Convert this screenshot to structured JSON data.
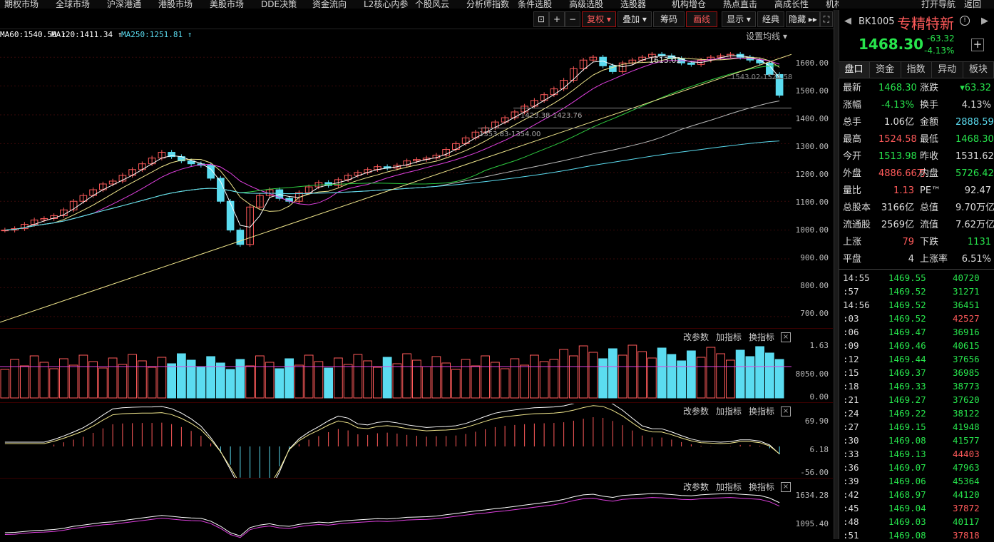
{
  "menu": {
    "items": [
      "期权市场",
      "全球市场",
      "沪深港通",
      "港股市场",
      "美股市场",
      "DDE决策",
      "资金流向",
      "L2核心内参",
      "个股风云",
      "分析师指数",
      "条件选股",
      "高级选股",
      "选股器",
      "机构增仓",
      "热点直击",
      "高成长性",
      "机构推荐"
    ],
    "right": [
      "打开导航",
      "返回"
    ]
  },
  "toolbar": {
    "buttons": [
      "+",
      "−",
      "复权 ▾",
      "叠加 ▾",
      "筹码",
      "画线",
      "显示 ▾",
      "经典",
      "隐藏 ▸▸"
    ]
  },
  "ma_legend": [
    {
      "text": "MA60:1540.50 ↑",
      "color": "#ffffff"
    },
    {
      "text": "MA120:1411.34 ↑",
      "color": "#ffffff"
    },
    {
      "text": "MA250:1251.81 ↑",
      "color": "#5bdcf0"
    }
  ],
  "settings_label": "设置均线 ▾",
  "price_axis": [
    "1600.00",
    "1500.00",
    "1400.00",
    "1300.00",
    "1200.00",
    "1100.00",
    "1000.00",
    "900.00",
    "800.00",
    "700.00"
  ],
  "annotations": {
    "high": "1613.02",
    "mid": "1543.02-1524.58",
    "line1": "1423.38-1423.76",
    "line2": "1353.83-1354.00"
  },
  "volume_axis": [
    "1.63",
    "8050.00",
    "0.00"
  ],
  "macd_axis": [
    "69.90",
    "6.18",
    "-56.00"
  ],
  "bottom_axis": [
    "1634.28",
    "1095.40"
  ],
  "pane_buttons": [
    "改参数",
    "加指标",
    "换指标"
  ],
  "stock": {
    "code": "BK1005",
    "name": "专精特新",
    "price": "1468.30",
    "change": "-63.32",
    "pct": "-4.13%"
  },
  "tabs": [
    "盘口",
    "资金",
    "指数",
    "异动",
    "板块"
  ],
  "quote": [
    [
      {
        "k": "最新",
        "v": "1468.30",
        "vc": "g"
      },
      {
        "k": "涨跌",
        "v": "▾63.32",
        "vc": "g"
      }
    ],
    [
      {
        "k": "涨幅",
        "v": "-4.13%",
        "vc": "g"
      },
      {
        "k": "换手",
        "v": "4.13%",
        "vc": "w"
      }
    ],
    [
      {
        "k": "总手",
        "v": "1.06亿",
        "vc": "w"
      },
      {
        "k": "金额",
        "v": "2888.59亿",
        "vc": "c"
      }
    ],
    [
      {
        "k": "最高",
        "v": "1524.58",
        "vc": "r"
      },
      {
        "k": "最低",
        "v": "1468.30",
        "vc": "g"
      }
    ],
    [
      {
        "k": "今开",
        "v": "1513.98",
        "vc": "g"
      },
      {
        "k": "昨收",
        "v": "1531.62",
        "vc": "w"
      }
    ],
    [
      {
        "k": "外盘",
        "v": "4886.66万",
        "vc": "r"
      },
      {
        "k": "内盘",
        "v": "5726.42万",
        "vc": "g"
      }
    ],
    [
      {
        "k": "量比",
        "v": "1.13",
        "vc": "r"
      },
      {
        "k": "PE™",
        "v": "92.47",
        "vc": "w"
      }
    ],
    [
      {
        "k": "总股本",
        "v": "3166亿",
        "vc": "w"
      },
      {
        "k": "总值",
        "v": "9.70万亿",
        "vc": "w"
      }
    ],
    [
      {
        "k": "流通股",
        "v": "2569亿",
        "vc": "w"
      },
      {
        "k": "流值",
        "v": "7.62万亿",
        "vc": "w"
      }
    ],
    [
      {
        "k": "上涨",
        "v": "79",
        "vc": "r"
      },
      {
        "k": "下跌",
        "v": "1131",
        "vc": "g"
      }
    ],
    [
      {
        "k": "平盘",
        "v": "4",
        "vc": "w"
      },
      {
        "k": "上涨率",
        "v": "6.51%",
        "vc": "w"
      }
    ]
  ],
  "ticks": [
    {
      "t": "14:55",
      "p": "1469.55",
      "v": "40720",
      "vc": "g"
    },
    {
      "t": ":57",
      "p": "1469.52",
      "v": "31271",
      "vc": "g"
    },
    {
      "t": "14:56",
      "p": "1469.52",
      "v": "36451",
      "vc": "g"
    },
    {
      "t": ":03",
      "p": "1469.52",
      "v": "42527",
      "vc": "r"
    },
    {
      "t": ":06",
      "p": "1469.47",
      "v": "36916",
      "vc": "g"
    },
    {
      "t": ":09",
      "p": "1469.46",
      "v": "40615",
      "vc": "g"
    },
    {
      "t": ":12",
      "p": "1469.44",
      "v": "37656",
      "vc": "g"
    },
    {
      "t": ":15",
      "p": "1469.37",
      "v": "36985",
      "vc": "g"
    },
    {
      "t": ":18",
      "p": "1469.33",
      "v": "38773",
      "vc": "g"
    },
    {
      "t": ":21",
      "p": "1469.27",
      "v": "37620",
      "vc": "g"
    },
    {
      "t": ":24",
      "p": "1469.22",
      "v": "38122",
      "vc": "g"
    },
    {
      "t": ":27",
      "p": "1469.15",
      "v": "41948",
      "vc": "g"
    },
    {
      "t": ":30",
      "p": "1469.08",
      "v": "41577",
      "vc": "g"
    },
    {
      "t": ":33",
      "p": "1469.13",
      "v": "44403",
      "vc": "r"
    },
    {
      "t": ":36",
      "p": "1469.07",
      "v": "47963",
      "vc": "g"
    },
    {
      "t": ":39",
      "p": "1469.06",
      "v": "45364",
      "vc": "g"
    },
    {
      "t": ":42",
      "p": "1468.97",
      "v": "44120",
      "vc": "g"
    },
    {
      "t": ":45",
      "p": "1469.04",
      "v": "37872",
      "vc": "r"
    },
    {
      "t": ":48",
      "p": "1469.03",
      "v": "40117",
      "vc": "g"
    },
    {
      "t": ":51",
      "p": "1469.08",
      "v": "37818",
      "vc": "r"
    }
  ],
  "chart_data": {
    "type": "candlestick",
    "price_range": [
      660,
      1650
    ],
    "close": [
      1000,
      1005,
      1020,
      1035,
      1040,
      1050,
      1070,
      1100,
      1120,
      1140,
      1160,
      1170,
      1190,
      1210,
      1230,
      1250,
      1270,
      1255,
      1240,
      1230,
      1225,
      1180,
      1100,
      1000,
      950,
      1080,
      1120,
      1140,
      1110,
      1100,
      1130,
      1150,
      1165,
      1155,
      1175,
      1190,
      1200,
      1210,
      1220,
      1215,
      1225,
      1240,
      1245,
      1250,
      1260,
      1280,
      1300,
      1320,
      1340,
      1355,
      1375,
      1390,
      1410,
      1430,
      1450,
      1470,
      1490,
      1520,
      1560,
      1590,
      1600,
      1570,
      1550,
      1580,
      1590,
      1600,
      1610,
      1605,
      1595,
      1580,
      1575,
      1590,
      1600,
      1605,
      1610,
      1600,
      1590,
      1580,
      1540,
      1468
    ],
    "ma_values": {
      "MA60": "1540.50",
      "MA120": "1411.34",
      "MA250": "1251.81"
    }
  }
}
